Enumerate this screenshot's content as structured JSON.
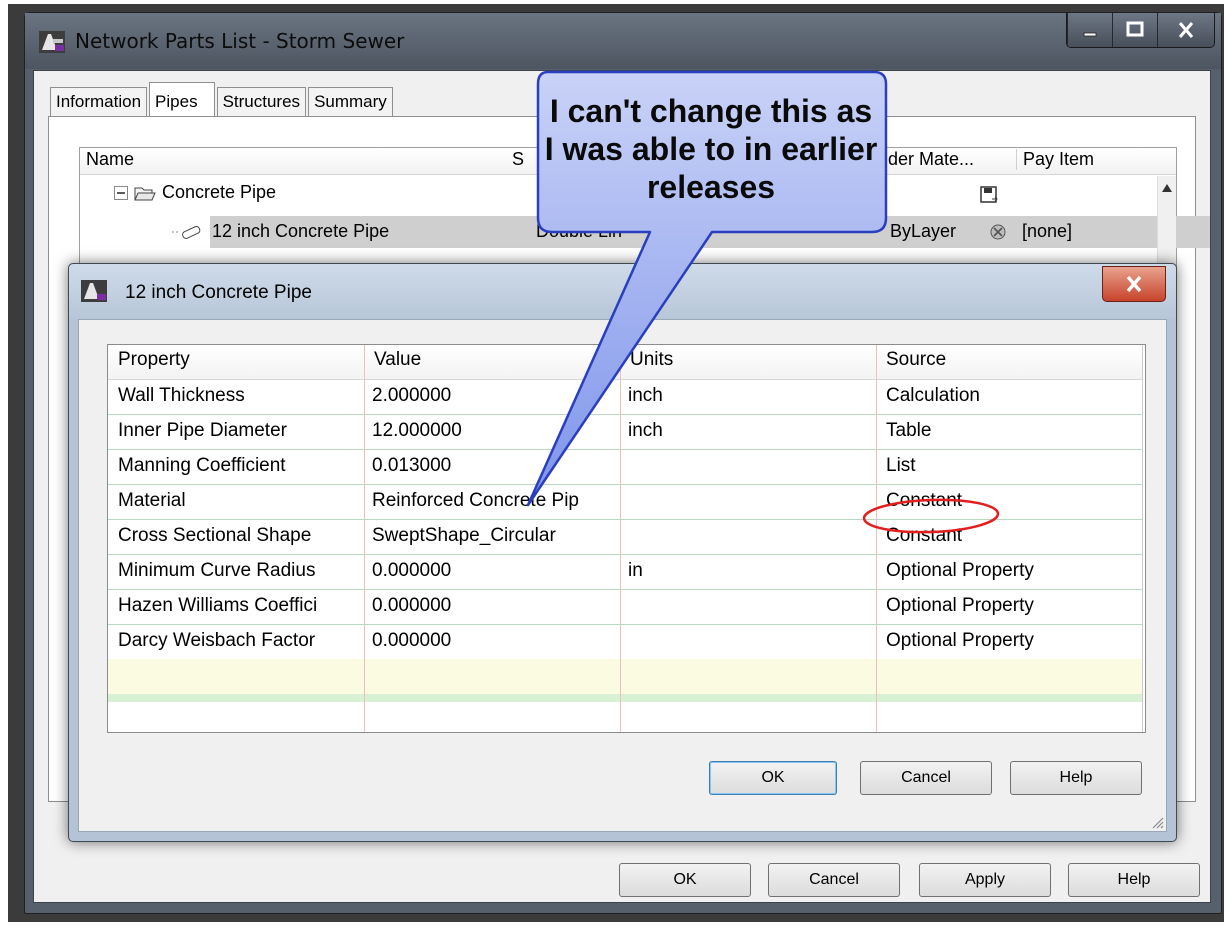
{
  "main_window": {
    "title": "Network Parts List - Storm Sewer",
    "tabs": [
      "Information",
      "Pipes",
      "Structures",
      "Summary"
    ],
    "active_tab": "Pipes",
    "columns": {
      "name": "Name",
      "size": "S",
      "render_material": "nder Mate...",
      "pay_item": "Pay Item"
    },
    "tree": {
      "group": "Concrete Pipe",
      "selected": {
        "name": "12 inch Concrete Pipe",
        "style": "Double Lin",
        "render_material": "ByLayer",
        "pay_item": "[none]"
      }
    },
    "buttons": {
      "ok": "OK",
      "cancel": "Cancel",
      "apply": "Apply",
      "help": "Help"
    }
  },
  "dialog": {
    "title": "12 inch Concrete Pipe",
    "columns": {
      "property": "Property",
      "value": "Value",
      "units": "Units",
      "source": "Source"
    },
    "rows": [
      {
        "property": "Wall Thickness",
        "value": "2.000000",
        "units": "inch",
        "source": "Calculation"
      },
      {
        "property": "Inner Pipe Diameter",
        "value": "12.000000",
        "units": "inch",
        "source": "Table"
      },
      {
        "property": "Manning Coefficient",
        "value": "0.013000",
        "units": "",
        "source": "List"
      },
      {
        "property": "Material",
        "value": "Reinforced Concrete Pip",
        "units": "",
        "source": "Constant"
      },
      {
        "property": "Cross Sectional Shape",
        "value": "SweptShape_Circular",
        "units": "",
        "source": "Constant"
      },
      {
        "property": "Minimum Curve Radius",
        "value": "0.000000",
        "units": "in",
        "source": "Optional Property"
      },
      {
        "property": "Hazen Williams Coeffici",
        "value": "0.000000",
        "units": "",
        "source": "Optional Property"
      },
      {
        "property": "Darcy Weisbach Factor",
        "value": "0.000000",
        "units": "",
        "source": "Optional Property"
      }
    ],
    "buttons": {
      "ok": "OK",
      "cancel": "Cancel",
      "help": "Help"
    }
  },
  "callout": {
    "text": "I can't change this as I was able to in earlier releases"
  },
  "colors": {
    "callout_fill": "#8ea2ef",
    "highlight_circle": "#e31e1e",
    "selected_row": "#cfcfcf"
  }
}
